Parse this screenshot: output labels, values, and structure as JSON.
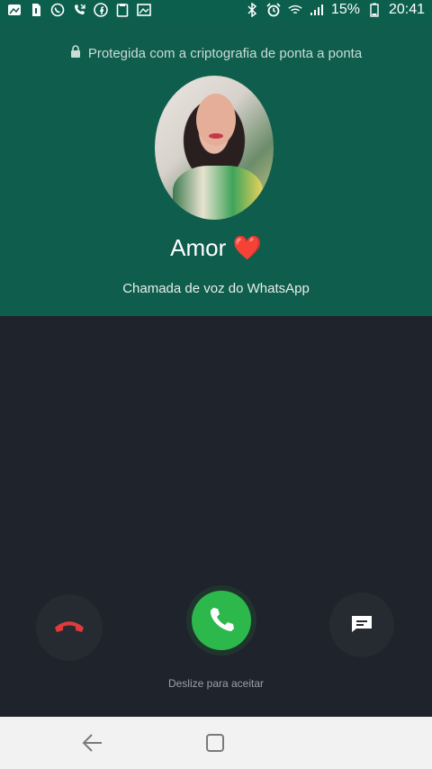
{
  "status_bar": {
    "battery_percent": "15%",
    "time": "20:41",
    "left_icons": [
      "gallery-icon",
      "sim-icon",
      "whatsapp-icon",
      "missed-call-icon",
      "facebook-icon",
      "clipboard-icon",
      "image-icon"
    ],
    "right_icons": [
      "bluetooth-icon",
      "alarm-icon",
      "wifi-icon",
      "signal-icon",
      "battery-icon"
    ]
  },
  "call": {
    "encryption_text": "Protegida com a criptografia de ponta a ponta",
    "contact_name": "Amor",
    "heart_emoji": "❤️",
    "subtitle": "Chamada de voz do WhatsApp",
    "slide_hint": "Deslize para aceitar"
  },
  "colors": {
    "header_green": "#0f5d4c",
    "accept_green": "#2db84c",
    "decline_red": "#e03a3a",
    "background": "#1f232b"
  },
  "navbar": {
    "icons": [
      "back-icon",
      "home-icon"
    ]
  }
}
